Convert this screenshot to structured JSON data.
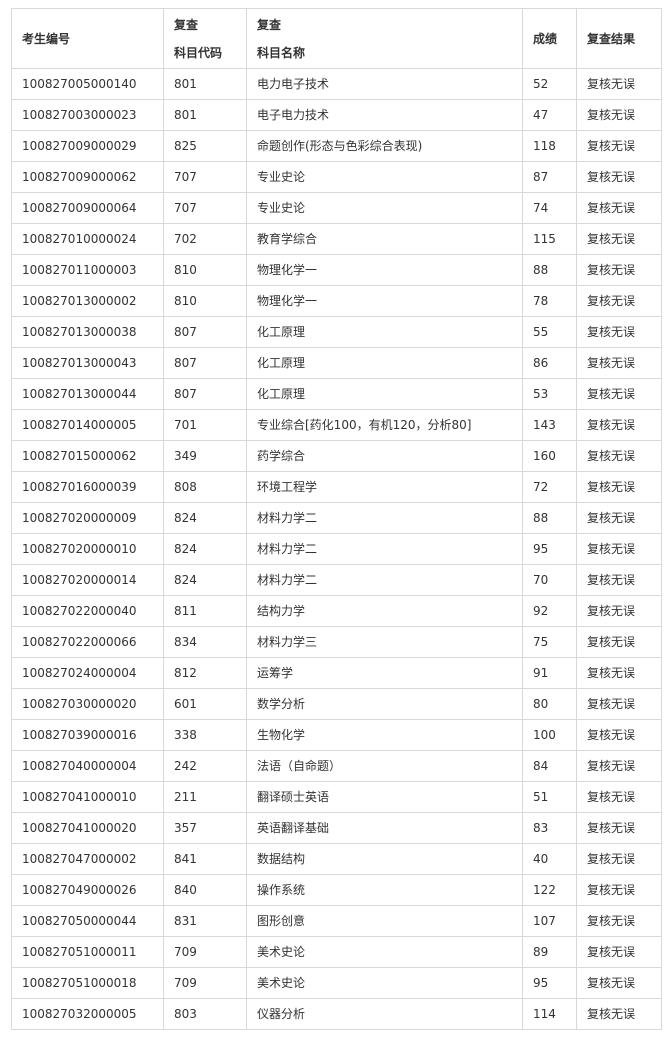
{
  "headers": {
    "exam_id": "考生编号",
    "code_line1": "复查",
    "code_line2": "科目代码",
    "name_line1": "复查",
    "name_line2": "科目名称",
    "score": "成绩",
    "result": "复查结果"
  },
  "rows": [
    {
      "id": "100827005000140",
      "code": "801",
      "name": "电力电子技术",
      "score": "52",
      "result": "复核无误"
    },
    {
      "id": "100827003000023",
      "code": "801",
      "name": "电子电力技术",
      "score": "47",
      "result": "复核无误"
    },
    {
      "id": "100827009000029",
      "code": "825",
      "name": "命题创作(形态与色彩综合表现)",
      "score": "118",
      "result": "复核无误"
    },
    {
      "id": "100827009000062",
      "code": "707",
      "name": "专业史论",
      "score": "87",
      "result": "复核无误"
    },
    {
      "id": "100827009000064",
      "code": "707",
      "name": "专业史论",
      "score": "74",
      "result": "复核无误"
    },
    {
      "id": "100827010000024",
      "code": "702",
      "name": "教育学综合",
      "score": "115",
      "result": "复核无误"
    },
    {
      "id": "100827011000003",
      "code": "810",
      "name": "物理化学一",
      "score": "88",
      "result": "复核无误"
    },
    {
      "id": "100827013000002",
      "code": "810",
      "name": "物理化学一",
      "score": "78",
      "result": "复核无误"
    },
    {
      "id": "100827013000038",
      "code": "807",
      "name": "化工原理",
      "score": "55",
      "result": "复核无误"
    },
    {
      "id": "100827013000043",
      "code": "807",
      "name": "化工原理",
      "score": "86",
      "result": "复核无误"
    },
    {
      "id": "100827013000044",
      "code": "807",
      "name": "化工原理",
      "score": "53",
      "result": "复核无误"
    },
    {
      "id": "100827014000005",
      "code": "701",
      "name": "专业综合[药化100，有机120，分析80]",
      "score": "143",
      "result": "复核无误"
    },
    {
      "id": "100827015000062",
      "code": "349",
      "name": "药学综合",
      "score": "160",
      "result": "复核无误"
    },
    {
      "id": "100827016000039",
      "code": "808",
      "name": "环境工程学",
      "score": "72",
      "result": "复核无误"
    },
    {
      "id": "100827020000009",
      "code": "824",
      "name": "材料力学二",
      "score": "88",
      "result": "复核无误"
    },
    {
      "id": "100827020000010",
      "code": "824",
      "name": "材料力学二",
      "score": "95",
      "result": "复核无误"
    },
    {
      "id": "100827020000014",
      "code": "824",
      "name": "材料力学二",
      "score": "70",
      "result": "复核无误"
    },
    {
      "id": "100827022000040",
      "code": "811",
      "name": "结构力学",
      "score": "92",
      "result": "复核无误"
    },
    {
      "id": "100827022000066",
      "code": "834",
      "name": "材料力学三",
      "score": "75",
      "result": "复核无误"
    },
    {
      "id": "100827024000004",
      "code": "812",
      "name": "运筹学",
      "score": "91",
      "result": "复核无误"
    },
    {
      "id": "100827030000020",
      "code": "601",
      "name": "数学分析",
      "score": "80",
      "result": "复核无误"
    },
    {
      "id": "100827039000016",
      "code": "338",
      "name": "生物化学",
      "score": "100",
      "result": "复核无误"
    },
    {
      "id": "100827040000004",
      "code": "242",
      "name": "法语（自命题）",
      "score": "84",
      "result": "复核无误"
    },
    {
      "id": "100827041000010",
      "code": "211",
      "name": "翻译硕士英语",
      "score": "51",
      "result": "复核无误"
    },
    {
      "id": "100827041000020",
      "code": "357",
      "name": "英语翻译基础",
      "score": "83",
      "result": "复核无误"
    },
    {
      "id": "100827047000002",
      "code": "841",
      "name": "数据结构",
      "score": "40",
      "result": "复核无误"
    },
    {
      "id": "100827049000026",
      "code": "840",
      "name": "操作系统",
      "score": "122",
      "result": "复核无误"
    },
    {
      "id": "100827050000044",
      "code": "831",
      "name": "图形创意",
      "score": "107",
      "result": "复核无误"
    },
    {
      "id": "100827051000011",
      "code": "709",
      "name": "美术史论",
      "score": "89",
      "result": "复核无误"
    },
    {
      "id": "100827051000018",
      "code": "709",
      "name": "美术史论",
      "score": "95",
      "result": "复核无误"
    },
    {
      "id": "100827032000005",
      "code": "803",
      "name": "仪器分析",
      "score": "114",
      "result": "复核无误"
    }
  ]
}
